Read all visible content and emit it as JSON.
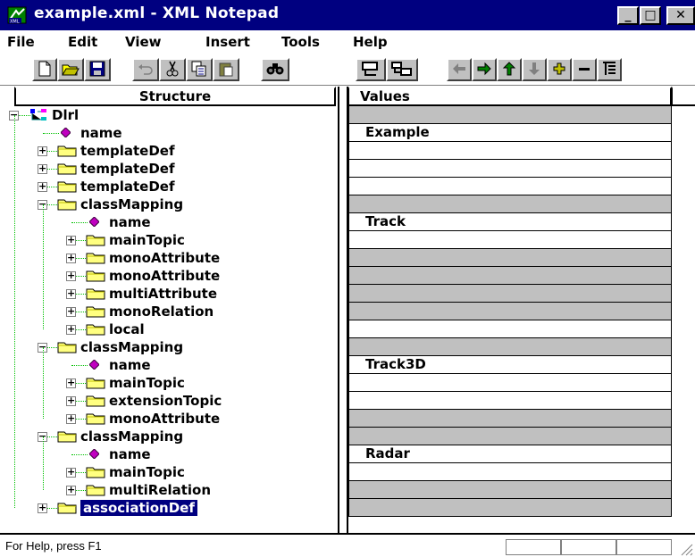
{
  "window": {
    "title": "example.xml - XML Notepad"
  },
  "menu": [
    "File",
    "Edit",
    "View",
    "Insert",
    "Tools",
    "Help"
  ],
  "toolbar": [
    "new-icon",
    "open-icon",
    "save-icon",
    "undo-icon",
    "cut-icon",
    "copy-icon",
    "paste-icon",
    "find-icon",
    "insert-element-icon",
    "insert-child-icon",
    "move-left-icon",
    "move-right-icon",
    "move-up-icon",
    "move-down-icon",
    "expand-icon",
    "collapse-icon",
    "goto-icon"
  ],
  "columns": {
    "structure": "Structure",
    "values": "Values"
  },
  "tree": [
    {
      "level": 0,
      "type": "root",
      "label": "Dlrl",
      "exp": "−",
      "value": "",
      "gray": true
    },
    {
      "level": 1,
      "type": "attr",
      "label": "name",
      "exp": "",
      "value": "Example",
      "gray": false
    },
    {
      "level": 1,
      "type": "folder",
      "label": "templateDef",
      "exp": "+",
      "value": "",
      "gray": false
    },
    {
      "level": 1,
      "type": "folder",
      "label": "templateDef",
      "exp": "+",
      "value": "",
      "gray": false
    },
    {
      "level": 1,
      "type": "folder",
      "label": "templateDef",
      "exp": "+",
      "value": "",
      "gray": false
    },
    {
      "level": 1,
      "type": "folder",
      "label": "classMapping",
      "exp": "−",
      "value": "",
      "gray": true
    },
    {
      "level": 2,
      "type": "attr",
      "label": "name",
      "exp": "",
      "value": "Track",
      "gray": false
    },
    {
      "level": 2,
      "type": "folder",
      "label": "mainTopic",
      "exp": "+",
      "value": "",
      "gray": false
    },
    {
      "level": 2,
      "type": "folder",
      "label": "monoAttribute",
      "exp": "+",
      "value": "",
      "gray": true
    },
    {
      "level": 2,
      "type": "folder",
      "label": "monoAttribute",
      "exp": "+",
      "value": "",
      "gray": true
    },
    {
      "level": 2,
      "type": "folder",
      "label": "multiAttribute",
      "exp": "+",
      "value": "",
      "gray": true
    },
    {
      "level": 2,
      "type": "folder",
      "label": "monoRelation",
      "exp": "+",
      "value": "",
      "gray": true
    },
    {
      "level": 2,
      "type": "folder",
      "label": "local",
      "exp": "+",
      "value": "",
      "gray": false
    },
    {
      "level": 1,
      "type": "folder",
      "label": "classMapping",
      "exp": "−",
      "value": "",
      "gray": true
    },
    {
      "level": 2,
      "type": "attr",
      "label": "name",
      "exp": "",
      "value": "Track3D",
      "gray": false
    },
    {
      "level": 2,
      "type": "folder",
      "label": "mainTopic",
      "exp": "+",
      "value": "",
      "gray": false
    },
    {
      "level": 2,
      "type": "folder",
      "label": "extensionTopic",
      "exp": "+",
      "value": "",
      "gray": false
    },
    {
      "level": 2,
      "type": "folder",
      "label": "monoAttribute",
      "exp": "+",
      "value": "",
      "gray": true
    },
    {
      "level": 1,
      "type": "folder",
      "label": "classMapping",
      "exp": "−",
      "value": "",
      "gray": true
    },
    {
      "level": 2,
      "type": "attr",
      "label": "name",
      "exp": "",
      "value": "Radar",
      "gray": false
    },
    {
      "level": 2,
      "type": "folder",
      "label": "mainTopic",
      "exp": "+",
      "value": "",
      "gray": false
    },
    {
      "level": 2,
      "type": "folder",
      "label": "multiRelation",
      "exp": "+",
      "value": "",
      "gray": true
    },
    {
      "level": 1,
      "type": "folder",
      "label": "associationDef",
      "exp": "+",
      "value": "",
      "gray": true,
      "selected": true
    }
  ],
  "status": {
    "text": "For Help, press F1"
  }
}
